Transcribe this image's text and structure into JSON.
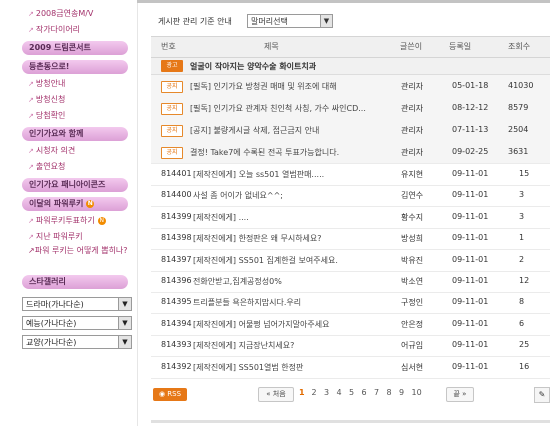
{
  "sidebar": {
    "links_top": [
      "2008금연송M/V",
      "작가다이어리"
    ],
    "sec1": "2009 드림콘서트",
    "sec2": "등촌동으로!",
    "links_sec2": [
      "방청안내",
      "방청신청",
      "당첨확인"
    ],
    "sec3": "인기가요와 함께",
    "links_sec3": [
      "시청자 의견",
      "출연요청"
    ],
    "sec4": "인기가요 패니아이콘즈",
    "sec5": "이달의 파워루키",
    "links_sec5": [
      "파워루키투표하기",
      "지난 파워루키"
    ],
    "rookie_question": "파워 루키는 어떻게 뽑히나?",
    "sec6": "스타갤러리",
    "selects": [
      "드라마(가나다순)",
      "예능(가나다순)",
      "교양(가나다순)"
    ]
  },
  "board": {
    "notice_label": "게시판 관리 기준 안내",
    "head_select": "말머리선택",
    "columns": {
      "no": "번호",
      "title": "제목",
      "writer": "글쓴이",
      "date": "등록일",
      "views": "조회수"
    },
    "ad": {
      "tag": "광고",
      "title": "얼굴이 작아지는 양악수술 화이트치과"
    },
    "notices": [
      {
        "tag": "공지",
        "title": "[필독] 인기가요 방청권 매매 및 위조에 대해",
        "writer": "관리자",
        "date": "05-01-18",
        "views": "41030"
      },
      {
        "tag": "공지",
        "title": "[필독] 인기가요 관계자 친인척 사칭, 가수 싸인CD...",
        "writer": "관리자",
        "date": "08-12-12",
        "views": "8579"
      },
      {
        "tag": "공지",
        "title": "[공지] 불량게시글 삭제, 접근금지 안내",
        "writer": "관리자",
        "date": "07-11-13",
        "views": "2504"
      },
      {
        "tag": "공지",
        "title": "결정! Take7에 수록된 전곡 투표가능합니다.",
        "writer": "관리자",
        "date": "09-02-25",
        "views": "3631"
      }
    ],
    "rows": [
      {
        "no": "814401",
        "title": "[제작진에게] 오늘 ss501 열범판매.....",
        "writer": "유지현",
        "date": "09-11-01",
        "views": "15"
      },
      {
        "no": "814400",
        "title": "사설 좀 어이가 없네요^^;",
        "writer": "김연수",
        "date": "09-11-01",
        "views": "3"
      },
      {
        "no": "814399",
        "title": "[제작진에게] ....",
        "writer": "황수지",
        "date": "09-11-01",
        "views": "3"
      },
      {
        "no": "814398",
        "title": "[제작진에게] 한정판은 왜 무시하세요?",
        "writer": "방성희",
        "date": "09-11-01",
        "views": "1"
      },
      {
        "no": "814397",
        "title": "[제작진에게] SS501 집계한걸 보여주세요.",
        "writer": "박유진",
        "date": "09-11-01",
        "views": "2"
      },
      {
        "no": "814396",
        "title": "전화안받고,집계공정성0%",
        "writer": "박소연",
        "date": "09-11-01",
        "views": "12"
      },
      {
        "no": "814395",
        "title": "트리플분들 욕은하지맙시다.우리",
        "writer": "구정인",
        "date": "09-11-01",
        "views": "8"
      },
      {
        "no": "814394",
        "title": "[제작진에게] 어물쩡 넘어가지말아주세요",
        "writer": "안은정",
        "date": "09-11-01",
        "views": "6"
      },
      {
        "no": "814393",
        "title": "[제작진에게] 지금장난치세요?",
        "writer": "어규임",
        "date": "09-11-01",
        "views": "25"
      },
      {
        "no": "814392",
        "title": "[제작진에게] SS501열범 한정판",
        "writer": "심서현",
        "date": "09-11-01",
        "views": "16"
      }
    ]
  },
  "pager": {
    "rss": "RSS",
    "first": "« 처음",
    "pages": [
      "1",
      "2",
      "3",
      "4",
      "5",
      "6",
      "7",
      "8",
      "9",
      "10"
    ],
    "current": "1",
    "next": "끝 »"
  }
}
